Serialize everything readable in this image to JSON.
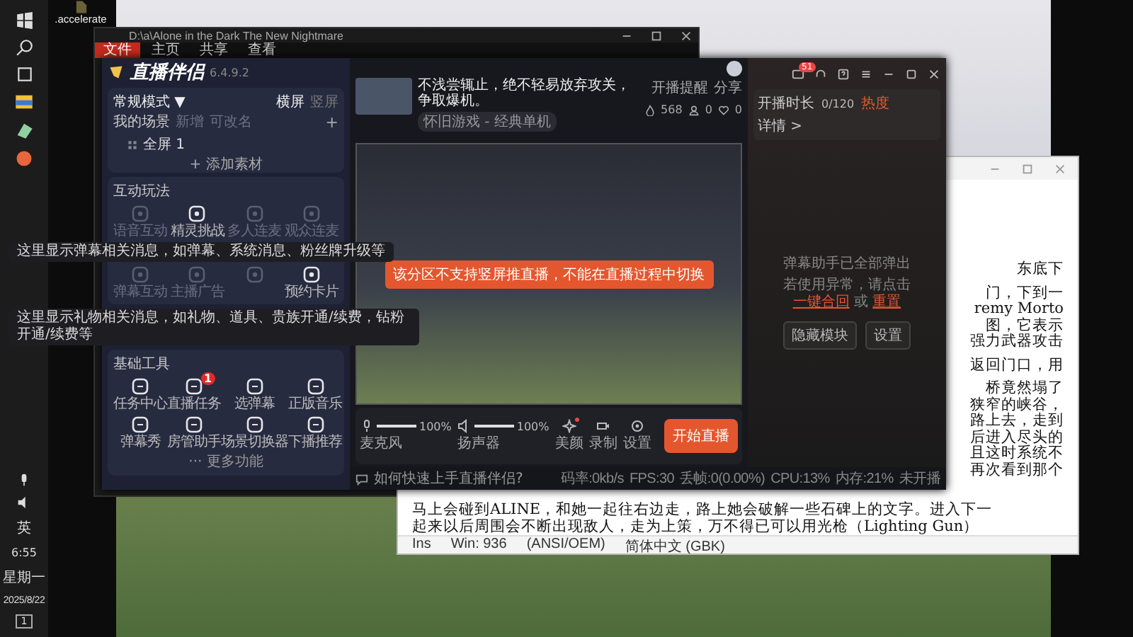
{
  "taskbar": {
    "time": "6:55",
    "weekday": "星期一",
    "date": "2025/8/22",
    "ime": "英",
    "notification_count": "1"
  },
  "desktop_icon": {
    "label": ".accelerate"
  },
  "explorer": {
    "title": "D:\\a\\Alone in the Dark The New Nightmare",
    "ribbon_tabs": [
      {
        "label": "文件",
        "selected": true
      },
      {
        "label": "主页",
        "selected": false
      },
      {
        "label": "共享",
        "selected": false
      },
      {
        "label": "查看",
        "selected": false
      }
    ]
  },
  "document": {
    "fragments": [
      {
        "text": "东底下",
        "gap_before": false
      },
      {
        "text": "门，下到一",
        "gap_before": true
      },
      {
        "text": "remy Morto",
        "gap_before": false
      },
      {
        "text": "图，它表示",
        "gap_before": false
      },
      {
        "text": "强力武器攻击",
        "gap_before": false
      },
      {
        "text": "返回门口，用",
        "gap_before": true
      },
      {
        "text": "桥竟然塌了",
        "gap_before": true
      },
      {
        "text": "狭窄的峡谷，",
        "gap_before": false
      },
      {
        "text": "路上去，走到",
        "gap_before": false
      },
      {
        "text": "后进入尽头的",
        "gap_before": false
      },
      {
        "text": "且这时系统不",
        "gap_before": false
      },
      {
        "text": "再次看到那个",
        "gap_before": false
      }
    ],
    "lines": [
      "马上会碰到ALINE，和她一起往右边走，路上她会破解一些石碑上的文字。进入下一",
      "起来以后周围会不断出现敌人，走为上策，万不得已可以用光枪（Lighting Gun）"
    ],
    "status_bar": [
      "Ins",
      "Win: 936",
      "(ANSI/OEM)",
      "简体中文 (GBK)"
    ]
  },
  "app": {
    "logo": "直播伴侣",
    "version": "6.4.9.2",
    "mode": "常规模式",
    "mode_caret": "▼",
    "orientations": [
      {
        "label": "横屏",
        "selected": true
      },
      {
        "label": "竖屏",
        "selected": false
      }
    ],
    "scenes_title": "我的场景",
    "scene_actions": [
      "新增",
      "可改名"
    ],
    "scene_add": "+",
    "scenes": [
      "全屏 1"
    ],
    "add_source": "+ 添加素材",
    "interaction": {
      "title": "互动玩法",
      "items": [
        {
          "label": "语音互动",
          "disabled": true
        },
        {
          "label": "精灵挑战",
          "disabled": false
        },
        {
          "label": "多人连麦",
          "disabled": true
        },
        {
          "label": "观众连麦",
          "disabled": true
        },
        {
          "label": "弹幕互动",
          "disabled": true
        },
        {
          "label": "主播广告",
          "disabled": true
        },
        {
          "disabled": true
        },
        {
          "label": "预约卡片",
          "disabled": false
        }
      ]
    },
    "tools": {
      "title": "基础工具",
      "items": [
        {
          "label": "任务中心"
        },
        {
          "label": "直播任务",
          "badge": "1"
        },
        {
          "label": "选弹幕"
        },
        {
          "label": "正版音乐"
        },
        {
          "label": "弹幕秀"
        },
        {
          "label": "房管助手"
        },
        {
          "label": "场景切换器"
        },
        {
          "label": "下播推荐"
        }
      ],
      "more": "··· 更多功能"
    },
    "stream": {
      "title": "不浅尝辄止，绝不轻易放弃攻关，争取爆机。",
      "category": "怀旧游戏 - 经典单机",
      "reminder": "开播提醒",
      "share": "分享",
      "stats": [
        {
          "kind": "fire",
          "value": "568"
        },
        {
          "kind": "person",
          "value": "0"
        },
        {
          "kind": "heart",
          "value": "0"
        }
      ]
    },
    "toast": "该分区不支持竖屏推直播，不能在直播过程中切换",
    "audio": [
      {
        "kind": "mic",
        "label": "麦克风",
        "level": 1,
        "reading": "100%"
      },
      {
        "kind": "speaker",
        "label": "扬声器",
        "level": 1,
        "reading": "100%"
      }
    ],
    "actions": [
      {
        "kind": "beauty",
        "label": "美颜",
        "alert": true
      },
      {
        "kind": "record",
        "label": "录制",
        "alert": false
      },
      {
        "kind": "settings",
        "label": "设置",
        "alert": false
      }
    ],
    "start_button": "开始直播",
    "help": "如何快速上手直播伴侣?",
    "status": [
      "码率:0kb/s",
      "FPS:30",
      "丢帧:0(0.00%)",
      "CPU:13%",
      "内存:21%",
      "未开播"
    ],
    "message_badge": "51",
    "live": {
      "label": "开播时长",
      "value": "0/120",
      "heat": "热度",
      "details": "详情 >"
    },
    "assistant": {
      "notice": "弹幕助手已全部弹出",
      "hint": "若使用异常，请点击",
      "link_1": "一键合回",
      "joiner": "或",
      "link_2": "重置",
      "buttons": [
        "隐藏模块",
        "设置"
      ]
    },
    "tooltips": [
      "这里显示弹幕相关消息，如弹幕、系统消息、粉丝牌升级等",
      "这里显示礼物相关消息，如礼物、道具、贵族开通/续费，钻粉开通/续费等"
    ]
  }
}
